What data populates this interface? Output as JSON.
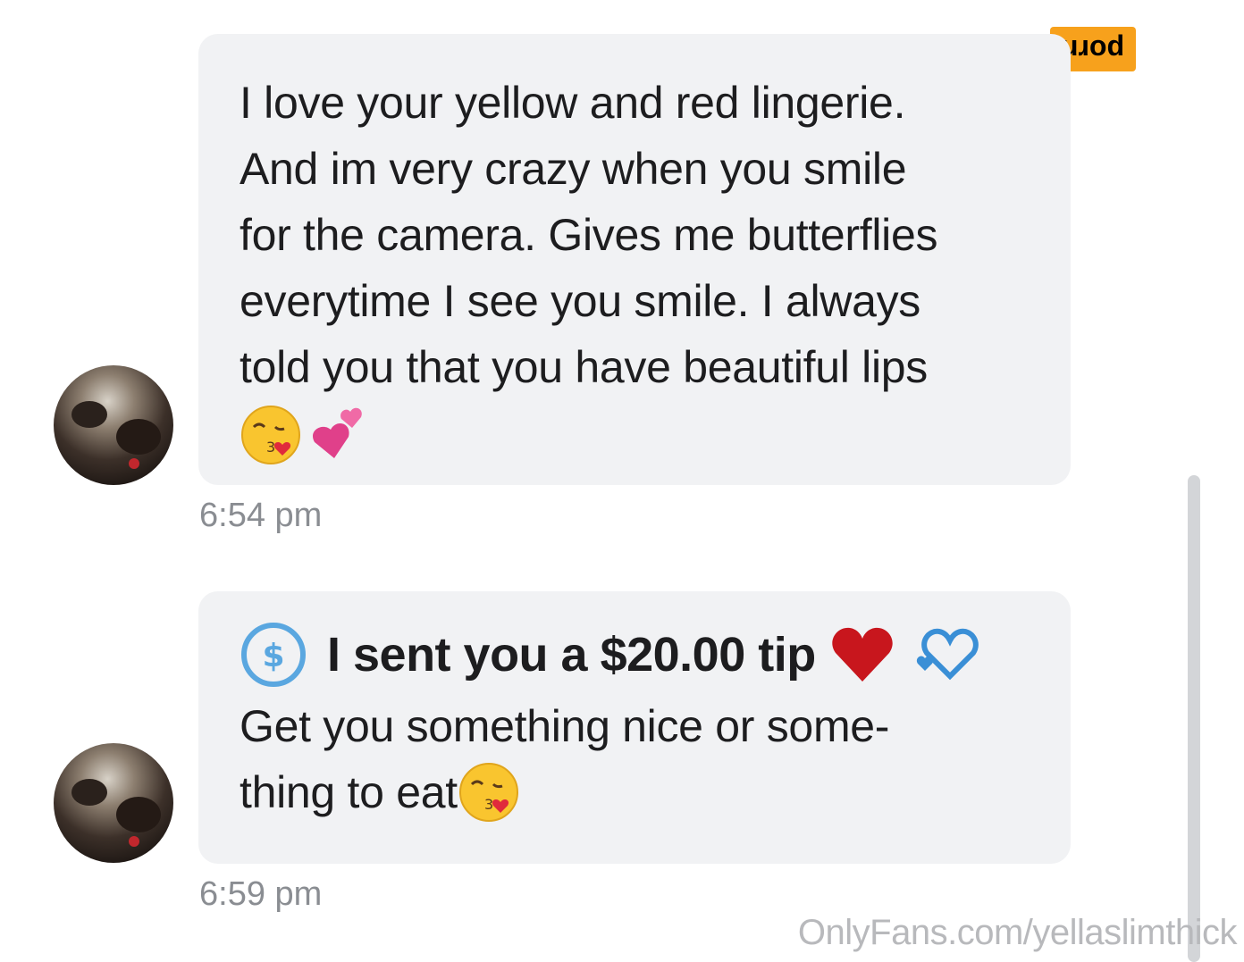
{
  "messages": [
    {
      "lines": [
        "I love your yellow and red lingerie.",
        "And im very crazy when you smile",
        "for the camera. Gives me butterflies",
        "everytime I see you smile. I always",
        "told you that you have beautiful lips"
      ],
      "emojis": [
        "kissing-face-emoji",
        "two-hearts-emoji"
      ],
      "time": "6:54 pm"
    },
    {
      "tip_icon": "dollar-circle-icon",
      "tip_text": "I sent you a $20.00 tip",
      "tip_emojis": [
        "red-heart-emoji",
        "blue-heart-emoji"
      ],
      "lines": [
        "Get you something nice or some-",
        "thing to eat"
      ],
      "trailing_emoji": "kissing-face-emoji",
      "time": "6:59 pm"
    }
  ],
  "watermark": "OnlyFans.com/yellaslimthick",
  "logo": "porn",
  "colors": {
    "bubble": "#f1f2f4",
    "timestamp": "#8a8d92",
    "tip_icon": "#5aa7e0",
    "logo_bg": "#f7a11c"
  }
}
